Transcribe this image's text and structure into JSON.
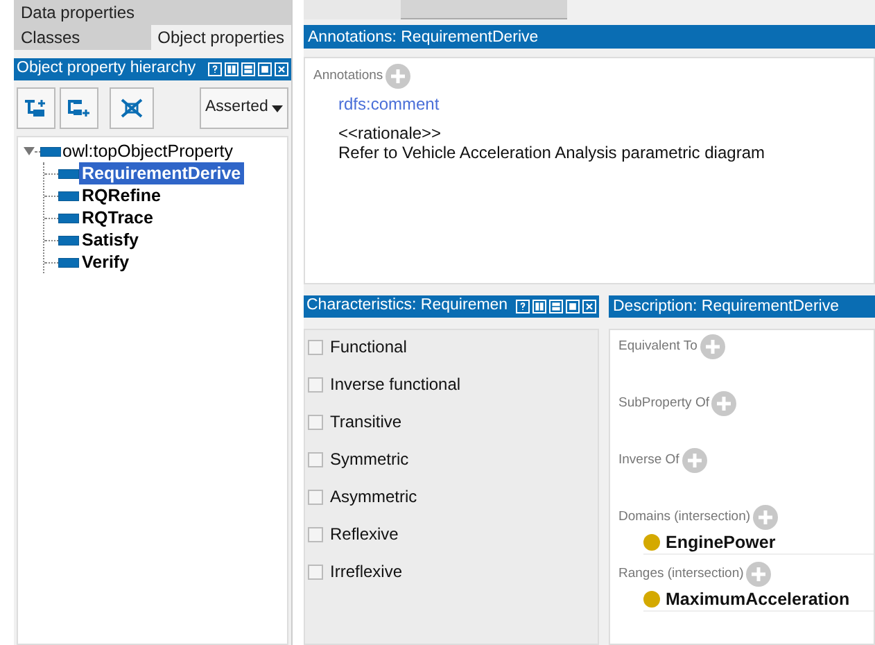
{
  "tab_rows": [
    [
      {
        "label": "Data properties",
        "selected": false
      }
    ],
    [
      {
        "label": "Classes",
        "selected": false
      },
      {
        "label": "Object properties",
        "selected": true
      }
    ]
  ],
  "hierarchy": {
    "title": "Object property hierarchy",
    "view_mode": "Asserted",
    "tree": {
      "label": "owl:topObjectProperty",
      "selected": false,
      "expanded": true,
      "children": [
        {
          "label": "RequirementDerive",
          "selected": true
        },
        {
          "label": "RQRefine",
          "selected": false
        },
        {
          "label": "RQTrace",
          "selected": false
        },
        {
          "label": "Satisfy",
          "selected": false
        },
        {
          "label": "Verify",
          "selected": false
        }
      ]
    }
  },
  "annotations": {
    "title": "Annotations: RequirementDerive",
    "section_label": "Annotations",
    "items": [
      {
        "property": "rdfs:comment",
        "lines": [
          "<<rationale>>",
          "Refer to Vehicle Acceleration Analysis parametric diagram"
        ]
      }
    ]
  },
  "characteristics": {
    "title": "Characteristics: Requiremen",
    "items": [
      {
        "label": "Functional",
        "checked": false
      },
      {
        "label": "Inverse functional",
        "checked": false
      },
      {
        "label": "Transitive",
        "checked": false
      },
      {
        "label": "Symmetric",
        "checked": false
      },
      {
        "label": "Asymmetric",
        "checked": false
      },
      {
        "label": "Reflexive",
        "checked": false
      },
      {
        "label": "Irreflexive",
        "checked": false
      }
    ]
  },
  "description": {
    "title": "Description: RequirementDerive",
    "sections": [
      {
        "label": "Equivalent To"
      },
      {
        "label": "SubProperty Of"
      },
      {
        "label": "Inverse Of"
      },
      {
        "label": "Domains (intersection)",
        "items": [
          {
            "name": "EnginePower",
            "color": "#d4a900"
          }
        ]
      },
      {
        "label": "Ranges (intersection)",
        "items": [
          {
            "name": "MaximumAcceleration",
            "color": "#d4a900"
          }
        ]
      }
    ]
  }
}
